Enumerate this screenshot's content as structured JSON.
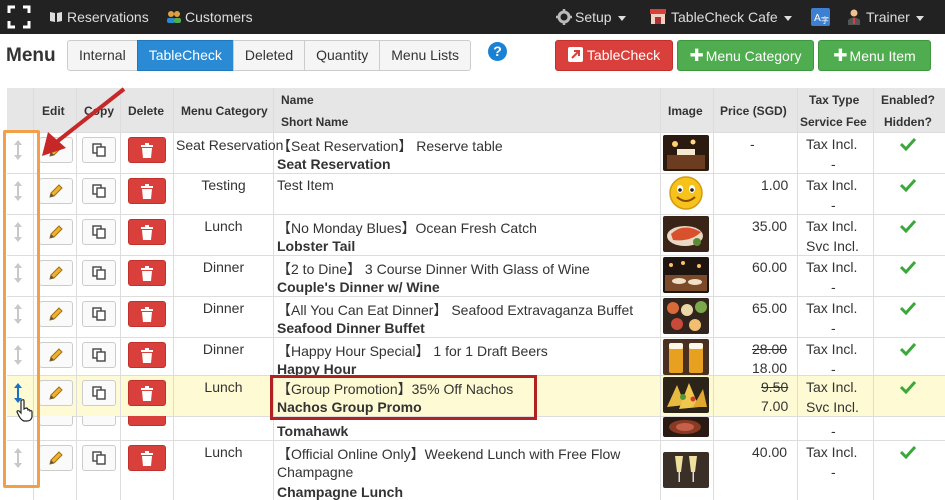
{
  "nav": {
    "reservations": "Reservations",
    "customers": "Customers",
    "setup": "Setup",
    "restaurant": "TableCheck Cafe",
    "user": "Trainer"
  },
  "page": {
    "title": "Menu",
    "tabs": [
      "Internal",
      "TableCheck",
      "Deleted",
      "Quantity",
      "Menu Lists"
    ],
    "active_tab": "TableCheck",
    "help": "?",
    "actions": {
      "tablecheck": "TableCheck",
      "menu_category": "Menu Category",
      "menu_item": "Menu Item"
    }
  },
  "table": {
    "headers": {
      "edit": "Edit",
      "copy": "Copy",
      "delete": "Delete",
      "category": "Menu Category",
      "name": "Name",
      "short_name": "Short Name",
      "image": "Image",
      "price": "Price (SGD)",
      "tax_type": "Tax Type",
      "service_fee": "Service Fee",
      "enabled": "Enabled?",
      "hidden": "Hidden?"
    },
    "rows": [
      {
        "category": "Seat Reservation",
        "name": "【Seat Reservation】 Reserve table",
        "short": "Seat Reservation",
        "price": "-",
        "price_old": "",
        "tax": "Tax Incl.",
        "fee": "-",
        "image": "restaurant"
      },
      {
        "category": "Testing",
        "name": "Test Item",
        "short": "",
        "price": "1.00",
        "price_old": "",
        "tax": "Tax Incl.",
        "fee": "-",
        "image": "emoji"
      },
      {
        "category": "Lunch",
        "name": "【No Monday Blues】Ocean Fresh Catch",
        "short": "Lobster Tail",
        "price": "35.00",
        "price_old": "",
        "tax": "Tax Incl.",
        "fee": "Svc Incl.",
        "image": "lobster"
      },
      {
        "category": "Dinner",
        "name": "【2 to Dine】 3 Course Dinner With Glass of Wine",
        "short": "Couple's Dinner w/ Wine",
        "price": "60.00",
        "price_old": "",
        "tax": "Tax Incl.",
        "fee": "-",
        "image": "dinner"
      },
      {
        "category": "Dinner",
        "name": "【All You Can Eat Dinner】 Seafood Extravaganza Buffet",
        "short": "Seafood Dinner Buffet",
        "price": "65.00",
        "price_old": "",
        "tax": "Tax Incl.",
        "fee": "-",
        "image": "buffet"
      },
      {
        "category": "Dinner",
        "name": "【Happy Hour Special】 1 for 1 Draft Beers",
        "short": "Happy Hour",
        "price": "18.00",
        "price_old": "28.00",
        "tax": "Tax Incl.",
        "fee": "-",
        "image": "beer"
      },
      {
        "category": "Lunch",
        "name": "【Group Promotion】35% Off Nachos",
        "short": "Nachos Group Promo",
        "price": "7.00",
        "price_old": "9.50",
        "tax": "Tax Incl.",
        "fee": "Svc Incl.",
        "image": "nachos"
      },
      {
        "category": "",
        "name": "",
        "short": "Tomahawk",
        "price": "",
        "price_old": "",
        "tax": "",
        "fee": "-",
        "image": "steak"
      },
      {
        "category": "Lunch",
        "name": "【Official Online Only】Weekend Lunch with Free Flow",
        "name2": "Champagne",
        "short": "Champagne Lunch",
        "price": "40.00",
        "price_old": "",
        "tax": "Tax Incl.",
        "fee": "-",
        "image": "champagne"
      }
    ]
  },
  "colors": {
    "navbar": "#222222",
    "active_tab": "#2a8ad4",
    "danger": "#d9403c",
    "success": "#4fad4f",
    "check": "#3aa83a",
    "highlight_row": "#fdfad4",
    "annotation_orange": "#f0a04b",
    "annotation_red": "#b22222"
  }
}
